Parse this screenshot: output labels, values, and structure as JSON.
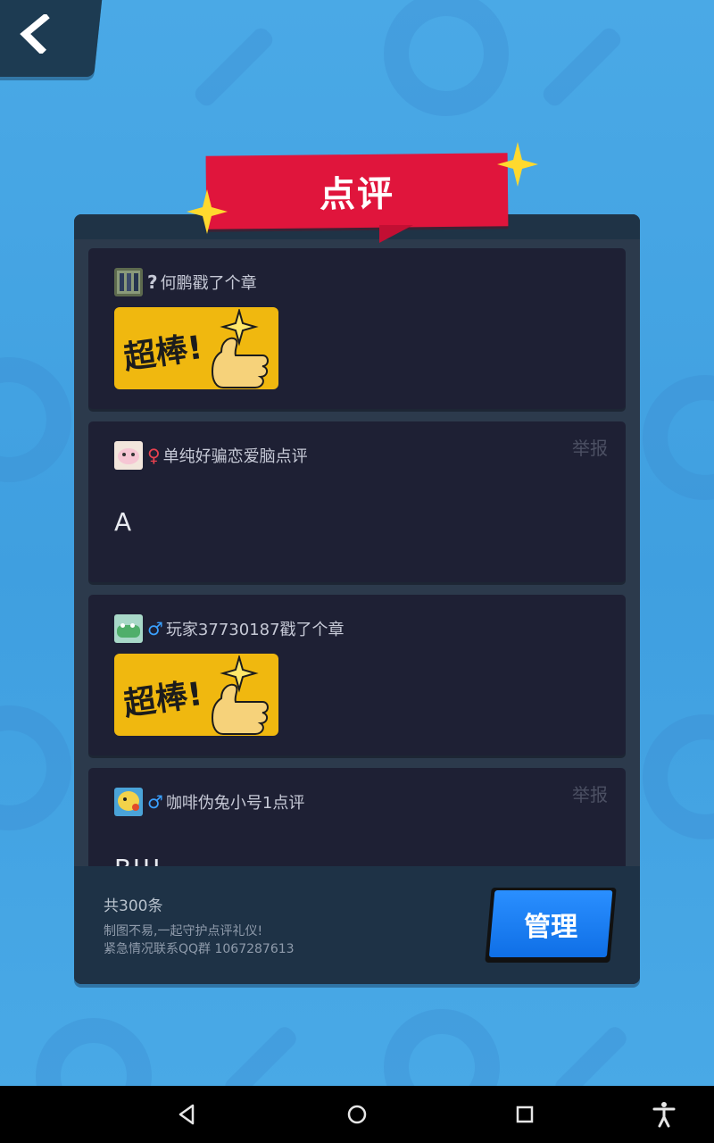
{
  "title": "点评",
  "total_count": "共300条",
  "notice_lines": [
    "制图不易,一起守护点评礼仪!",
    "紧急情况联系QQ群 1067287613"
  ],
  "manage_label": "管理",
  "report_label": "举报",
  "sticker_label": "超棒!",
  "comments": [
    {
      "gender": "?",
      "gender_color": "#c6c9d6",
      "text": "何鹏戳了个章",
      "kind": "sticker"
    },
    {
      "gender": "♀",
      "gender_color": "#e8414f",
      "text": "单纯好骗恋爱脑点评",
      "kind": "comment",
      "body": "A",
      "report": true
    },
    {
      "gender": "♂",
      "gender_color": "#3aa0ff",
      "text": "玩家37730187戳了个章",
      "kind": "sticker"
    },
    {
      "gender": "♂",
      "gender_color": "#3aa0ff",
      "text": "咖啡伪兔小号1点评",
      "kind": "comment",
      "body": "B!!!",
      "report": true
    }
  ],
  "colors": {
    "background": "#46a6e4",
    "ribbon": "#e0153c",
    "panel": "#2c3a4c",
    "card": "#1e2034",
    "sticker": "#f0b80f",
    "manage_button": "#1a7ff5"
  },
  "icons": [
    "back-arrow-icon",
    "sparkle-icon",
    "nav-back-icon",
    "nav-home-icon",
    "nav-recents-icon",
    "accessibility-icon"
  ]
}
